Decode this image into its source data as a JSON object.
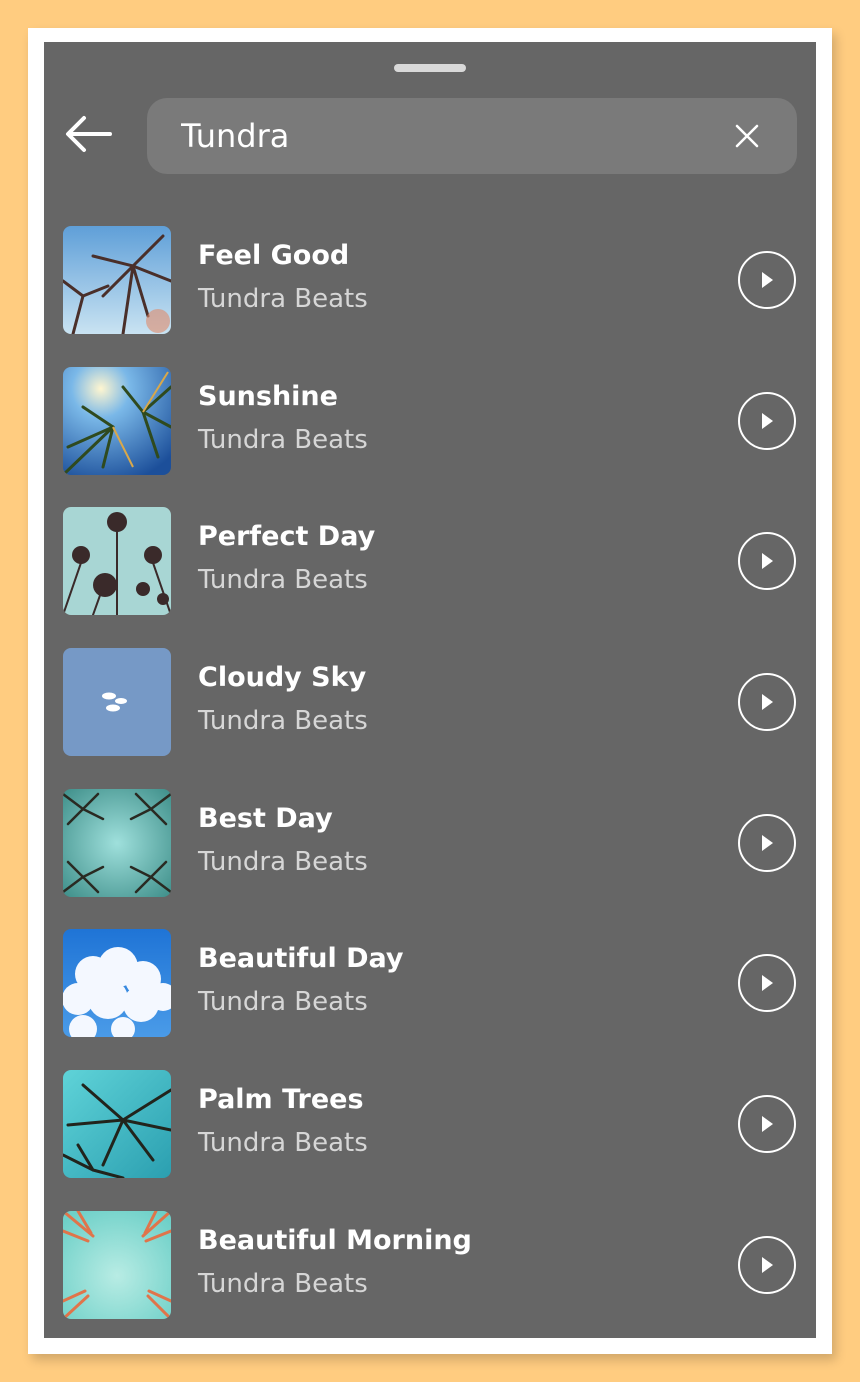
{
  "search": {
    "value": "Tundra"
  },
  "icons": {
    "back": "back-arrow-icon",
    "clear": "close-icon",
    "play": "play-icon"
  },
  "colors": {
    "background": "#ffcc80",
    "panel": "#666666",
    "search_field": "#7a7a7a",
    "text_primary": "#ffffff",
    "text_secondary": "#d6d6d6"
  },
  "tracks": [
    {
      "title": "Feel Good",
      "artist": "Tundra Beats"
    },
    {
      "title": "Sunshine",
      "artist": "Tundra Beats"
    },
    {
      "title": "Perfect Day",
      "artist": "Tundra Beats"
    },
    {
      "title": "Cloudy Sky",
      "artist": "Tundra Beats"
    },
    {
      "title": "Best Day",
      "artist": "Tundra Beats"
    },
    {
      "title": "Beautiful Day",
      "artist": "Tundra Beats"
    },
    {
      "title": "Palm Trees",
      "artist": "Tundra Beats"
    },
    {
      "title": "Beautiful Morning",
      "artist": "Tundra Beats"
    }
  ]
}
